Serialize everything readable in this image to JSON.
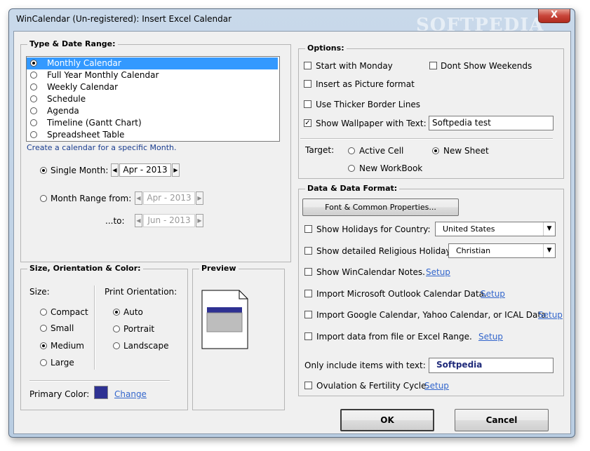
{
  "window": {
    "title": "WinCalendar (Un-registered): Insert Excel Calendar",
    "close_label": "X",
    "watermark": "SOFTPEDIA"
  },
  "type_range": {
    "title": "Type & Date Range:",
    "items": [
      {
        "label": "Monthly Calendar",
        "selected": true
      },
      {
        "label": "Full Year Monthly Calendar",
        "selected": false
      },
      {
        "label": "Weekly Calendar",
        "selected": false
      },
      {
        "label": "Schedule",
        "selected": false
      },
      {
        "label": "Agenda",
        "selected": false
      },
      {
        "label": "Timeline (Gantt Chart)",
        "selected": false
      },
      {
        "label": "Spreadsheet Table",
        "selected": false
      }
    ],
    "description": "Create a calendar for a specific Month.",
    "single_month_label": "Single Month:",
    "single_month_value": "Apr - 2013",
    "range_from_label": "Month Range from:",
    "range_from_value": "Apr - 2013",
    "range_to_label": "...to:",
    "range_to_value": "Jun - 2013"
  },
  "size_color": {
    "title": "Size, Orientation & Color:",
    "size_label": "Size:",
    "sizes": [
      "Compact",
      "Small",
      "Medium",
      "Large"
    ],
    "size_selected": "Medium",
    "orientation_label": "Print Orientation:",
    "orientations": [
      "Auto",
      "Portrait",
      "Landscape"
    ],
    "orientation_selected": "Auto",
    "primary_color_label": "Primary Color:",
    "primary_color": "#2e3192",
    "change_link": "Change"
  },
  "preview": {
    "title": "Preview"
  },
  "options": {
    "title": "Options:",
    "start_monday": "Start with Monday",
    "dont_show_weekends": "Dont Show Weekends",
    "insert_picture": "Insert as Picture format",
    "thicker_border": "Use Thicker Border Lines",
    "show_wallpaper": "Show Wallpaper with Text:",
    "wallpaper_text": "Softpedia test",
    "target_label": "Target:",
    "active_cell": "Active Cell",
    "new_sheet": "New Sheet",
    "new_workbook": "New WorkBook"
  },
  "data_format": {
    "title": "Data & Data Format:",
    "font_button": "Font & Common Properties...",
    "holidays_label": "Show Holidays for Country:",
    "holidays_country": "United States",
    "religious_label": "Show detailed Religious Holidays:",
    "religious_value": "Christian",
    "notes_label": "Show WinCalendar Notes.",
    "outlook_label": "Import Microsoft Outlook Calendar Data.",
    "google_label": "Import Google Calendar, Yahoo Calendar, or ICAL Data.",
    "file_label": "Import data from file or Excel Range.",
    "setup_link": "Setup",
    "filter_label": "Only include items with text:",
    "filter_value": "Softpedia",
    "ovulation_label": "Ovulation & Fertility Cycle."
  },
  "footer": {
    "ok": "OK",
    "cancel": "Cancel"
  }
}
